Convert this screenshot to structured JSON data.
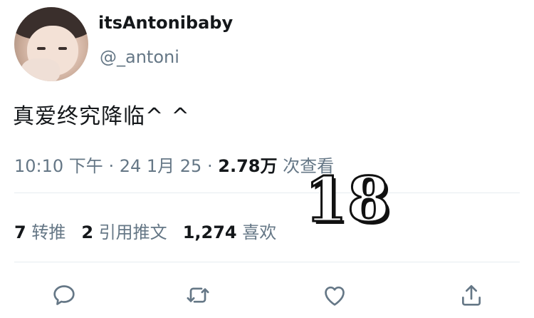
{
  "tweet": {
    "display_name": "itsAntonibaby",
    "handle": "@_antoni",
    "text": "真爱终究降临^ ^",
    "time": "10:10 下午",
    "dot": "·",
    "date": "24 1月 25",
    "views_count": "2.78万",
    "views_label": "次查看"
  },
  "stats": {
    "retweets_count": "7",
    "retweets_label": "转推",
    "quotes_count": "2",
    "quotes_label": "引用推文",
    "likes_count": "1,274",
    "likes_label": "喜欢"
  },
  "overlay": {
    "sticker_text": "18"
  },
  "actions": [
    "reply-icon",
    "retweet-icon",
    "like-icon",
    "share-icon"
  ],
  "colors": {
    "primary_text": "#14171a",
    "secondary_text": "#657786",
    "divider": "#e6ecf0"
  }
}
